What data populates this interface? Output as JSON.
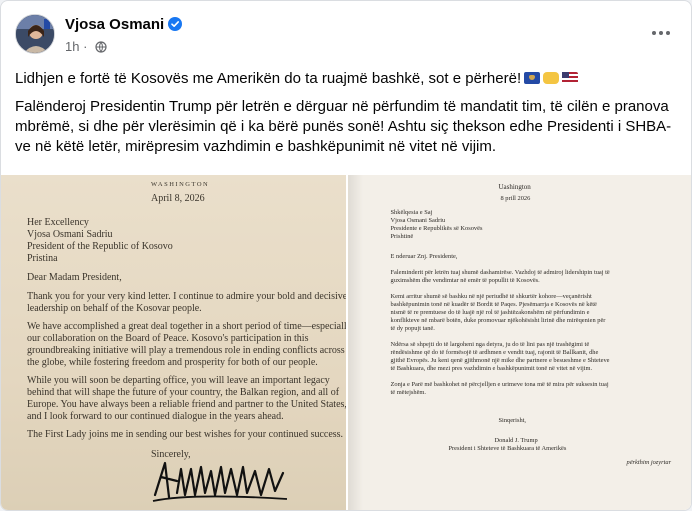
{
  "post": {
    "author": "Vjosa Osmani",
    "time": "1h",
    "text_line1": "Lidhjen e fortë të Kosovës me Amerikën do ta ruajmë bashkë, sot e përherë!",
    "text_para2": "Falënderoj Presidentin Trump për letrën e dërguar në përfundim të mandatit tim, të cilën e pranova mbrëmë, si dhe për vlerësimin që i ka bërë punës sonë! Ashtu siç thekson edhe Presidenti i SHBA-ve në këtë letër, mirëpresim vazhdimin e bashkëpunimit në vitet në vijim.",
    "icons": [
      "verified-badge-icon",
      "globe-icon",
      "more-options-icon",
      "kosovo-flag-icon",
      "handshake-icon",
      "us-flag-icon"
    ]
  },
  "letter_en": {
    "letterhead": "WASHINGTON",
    "date": "April 8, 2026",
    "addr1": "Her Excellency",
    "addr2": "Vjosa Osmani Sadriu",
    "addr3": "President of the Republic of Kosovo",
    "addr4": "Pristina",
    "salutation": "Dear Madam President,",
    "p1_l1": "Thank you for your very kind letter.  I continue to admire your bold and decisive",
    "p1_l2": "leadership on behalf of the Kosovar people.",
    "p2_l1": "We have accomplished a great deal together in a short period of time—especially",
    "p2_l2": "our collaboration on the Board of Peace.  Kosovo's participation in this",
    "p2_l3": "groundbreaking initiative will play a tremendous role in ending conflicts across",
    "p2_l4": "the globe, while fostering freedom and prosperity for both of our people.",
    "p3_l1": "While you will soon be departing office, you will leave an important legacy",
    "p3_l2": "behind that will shape the future of your country, the Balkan region, and all of",
    "p3_l3": "Europe.  You have always been a reliable friend and partner to the United States,",
    "p3_l4": "and I look forward to our continued dialogue in the years ahead.",
    "p4_l1": "The First Lady joins me in sending our best wishes for your continued success.",
    "closing": "Sincerely,"
  },
  "letter_sq": {
    "letterhead": "Uashington",
    "date": "8 prill 2026",
    "addr1": "Shkëlqesia e Saj",
    "addr2": "Vjosa Osmani Sadriu",
    "addr3": "Presidente e Republikës së Kosovës",
    "addr4": "Prishtinë",
    "salutation": "E nderuar Znj. Presidente,",
    "p1_l1": "Faleminderit për letrën tuaj shumë dashamirëse. Vazhdoj të admiroj lidershipin tuaj të",
    "p1_l2": "guximshëm dhe vendimtar në emër të popullit të Kosovës.",
    "p2_l1": "Kemi arritur shumë së bashku në një periudhë të shkurtër kohore—veçanërisht",
    "p2_l2": "bashkëpunimin tonë në kuadër të Bordit të Paqes. Pjesëmarrja e Kosovës në këtë",
    "p2_l3": "nismë të re premtuese do të luajë një rol të jashtëzakonshëm në përfundimin e",
    "p2_l4": "konflikteve në mbarë botën, duke promovuar njëkohësisht lirinë dhe mirëqenien për",
    "p2_l5": "të dy popujt tanë.",
    "p3_l1": "Ndërsa së shpejti do të largoheni nga detyra, ju do të lini pas një trashëgimi të",
    "p3_l2": "rëndësishme që do të formësojë të ardhmen e vendit tuaj, rajonit të Ballkanit, dhe",
    "p3_l3": "gjithë Evropës. Ju keni qenë gjithmonë një mike dhe partnere e besueshme e Shteteve",
    "p3_l4": "të Bashkuara, dhe mezi pres vazhdimin e bashkëpunimit tonë në vitet në vijim.",
    "p4_l1": "Zonja e Parë më bashkohet në përcjelljen e urimeve tona më të mira për suksesin tuaj",
    "p4_l2": "të mëtejshëm.",
    "closing": "Sinqerisht,",
    "signer": "Donald J. Trump",
    "signer_title": "President i Shteteve të Bashkuara të Amerikës",
    "note": "përkthim jozyrtar"
  }
}
